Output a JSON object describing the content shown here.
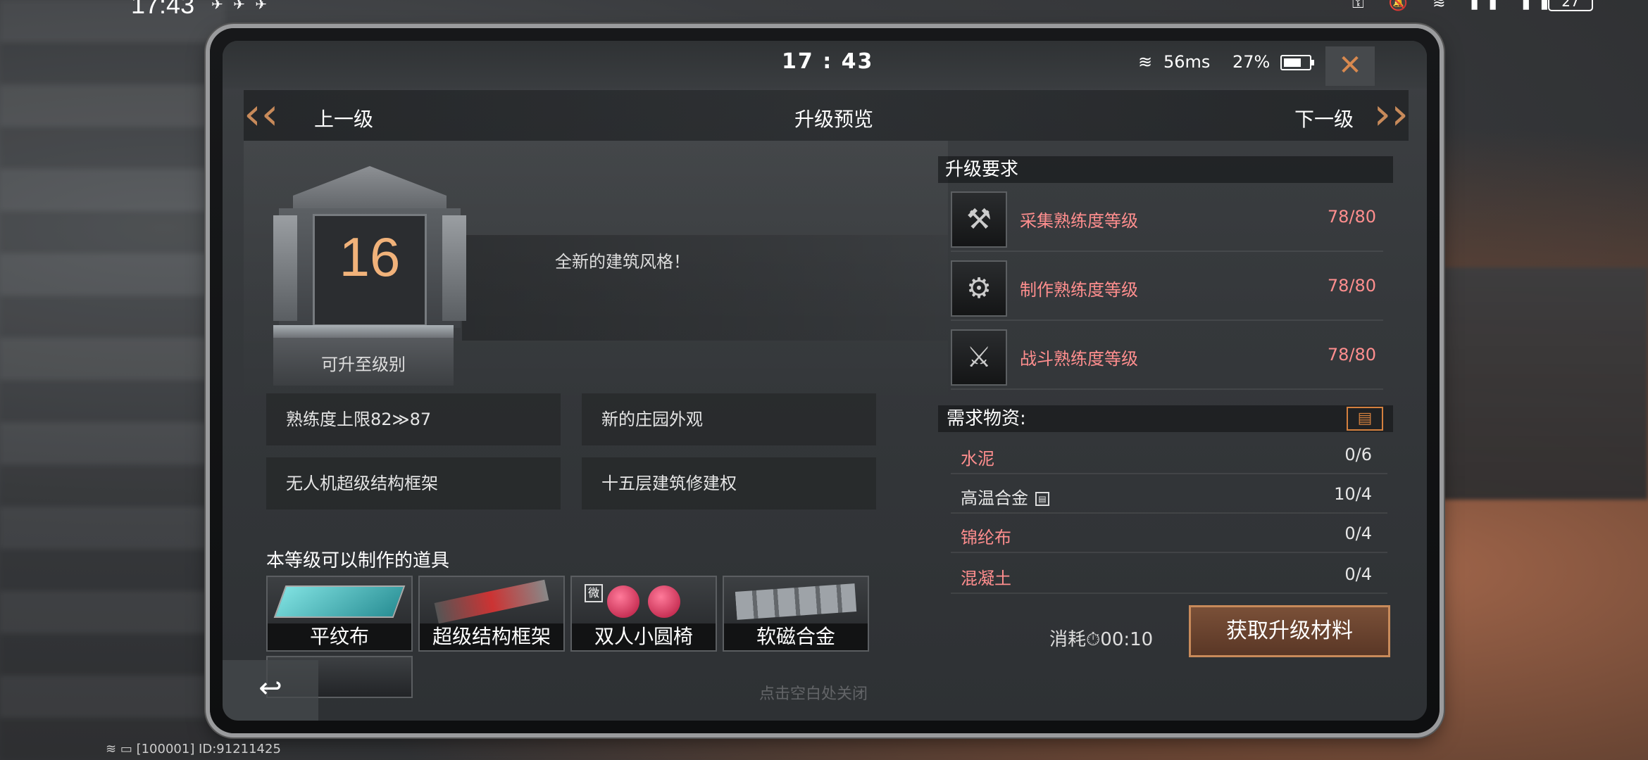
{
  "phone_status": {
    "time": "17:43",
    "notifications": "✈ ✈ ✈",
    "right_icons": "⚿ 🔕 ≋ ▮▮ ▮▮",
    "battery": "27"
  },
  "game_status": {
    "clock": "17 : 43",
    "ping": "56ms",
    "battery_pct": "27%"
  },
  "nav": {
    "prev": "上一级",
    "title": "升级预览",
    "next": "下一级"
  },
  "level": {
    "number": "16",
    "label": "可升至级别",
    "feature": "全新的建筑风格！"
  },
  "perks": [
    "熟练度上限82≫87",
    "新的庄园外观",
    "无人机超级结构框架",
    "十五层建筑修建权"
  ],
  "craft": {
    "title": "本等级可以制作的道具",
    "items": [
      {
        "name": "平纹布"
      },
      {
        "name": "超级结构框架"
      },
      {
        "name": "双人小圆椅",
        "tag": "微"
      },
      {
        "name": "软磁合金"
      }
    ]
  },
  "requirements": {
    "title": "升级要求",
    "rows": [
      {
        "name": "采集熟练度等级",
        "value": "78/80"
      },
      {
        "name": "制作熟练度等级",
        "value": "78/80"
      },
      {
        "name": "战斗熟练度等级",
        "value": "78/80"
      }
    ]
  },
  "materials": {
    "title": "需求物资:",
    "rows": [
      {
        "name": "水泥",
        "value": "0/6",
        "status": "low"
      },
      {
        "name": "高温合金",
        "value": "10/4",
        "status": "ok"
      },
      {
        "name": "锦纶布",
        "value": "0/4",
        "status": "low"
      },
      {
        "name": "混凝土",
        "value": "0/4",
        "status": "low"
      }
    ]
  },
  "cost": {
    "label": "消耗",
    "time": "00:10"
  },
  "action": {
    "get_materials": "获取升级材料",
    "tap_close": "点击空白处关闭"
  },
  "footer": {
    "id_text": "[100001] ID:91211425"
  },
  "colors": {
    "accent": "#c88a5a",
    "insufficient": "#ff8e8e",
    "level_number": "#f1b27a"
  }
}
